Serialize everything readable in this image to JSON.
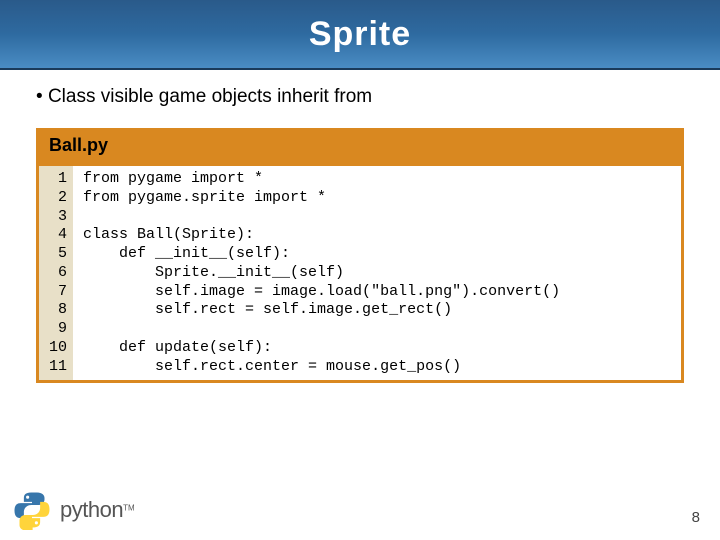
{
  "title": "Sprite",
  "bullet_text": "Class visible game objects inherit from",
  "code": {
    "filename": "Ball.py",
    "line_numbers": "1\n2\n3\n4\n5\n6\n7\n8\n9\n10\n11",
    "source": "from pygame import *\nfrom pygame.sprite import *\n\nclass Ball(Sprite):\n    def __init__(self):\n        Sprite.__init__(self)\n        self.image = image.load(\"ball.png\").convert()\n        self.rect = self.image.get_rect()\n\n    def update(self):\n        self.rect.center = mouse.get_pos()"
  },
  "footer": {
    "logo_text": "python",
    "tm": "TM"
  },
  "page_number": "8"
}
